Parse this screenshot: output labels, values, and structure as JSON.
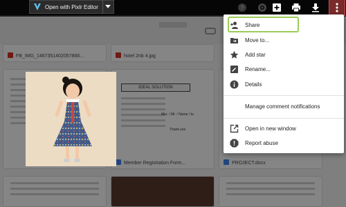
{
  "toolbar": {
    "open_with_label": "Open with Pixlr Editor",
    "icons": [
      "comment-icon",
      "gear-icon",
      "add-to-drive-icon",
      "print-icon",
      "download-icon",
      "more-vert-icon"
    ]
  },
  "background": {
    "cards": [
      {
        "caption": "FB_IMG_1467351402057866..."
      },
      {
        "caption": "hotel 2nb 4.jpg"
      },
      {
        "caption": "Member Registration Form..."
      },
      {
        "caption": "PROJECT.docx"
      }
    ],
    "form_title": "IDEAL SOLUTION",
    "preview_handwriting": [
      "Mrs. / Mr. / Name / to",
      "Thank you"
    ]
  },
  "menu": {
    "items": [
      {
        "label": "Share",
        "icon": "person-add-icon"
      },
      {
        "label": "Move to...",
        "icon": "move-to-folder-icon"
      },
      {
        "label": "Add star",
        "icon": "star-icon"
      },
      {
        "label": "Rename...",
        "icon": "rename-icon"
      },
      {
        "label": "Details",
        "icon": "info-icon"
      },
      {
        "label": "Manage comment notifications",
        "icon": ""
      },
      {
        "label": "Open in new window",
        "icon": "open-in-new-icon"
      },
      {
        "label": "Report abuse",
        "icon": "report-icon"
      }
    ]
  },
  "colors": {
    "highlight": "#9acd57",
    "active_more_button": "#7a2a2a",
    "pdf_red": "#d93025",
    "doc_blue": "#4285f4"
  }
}
